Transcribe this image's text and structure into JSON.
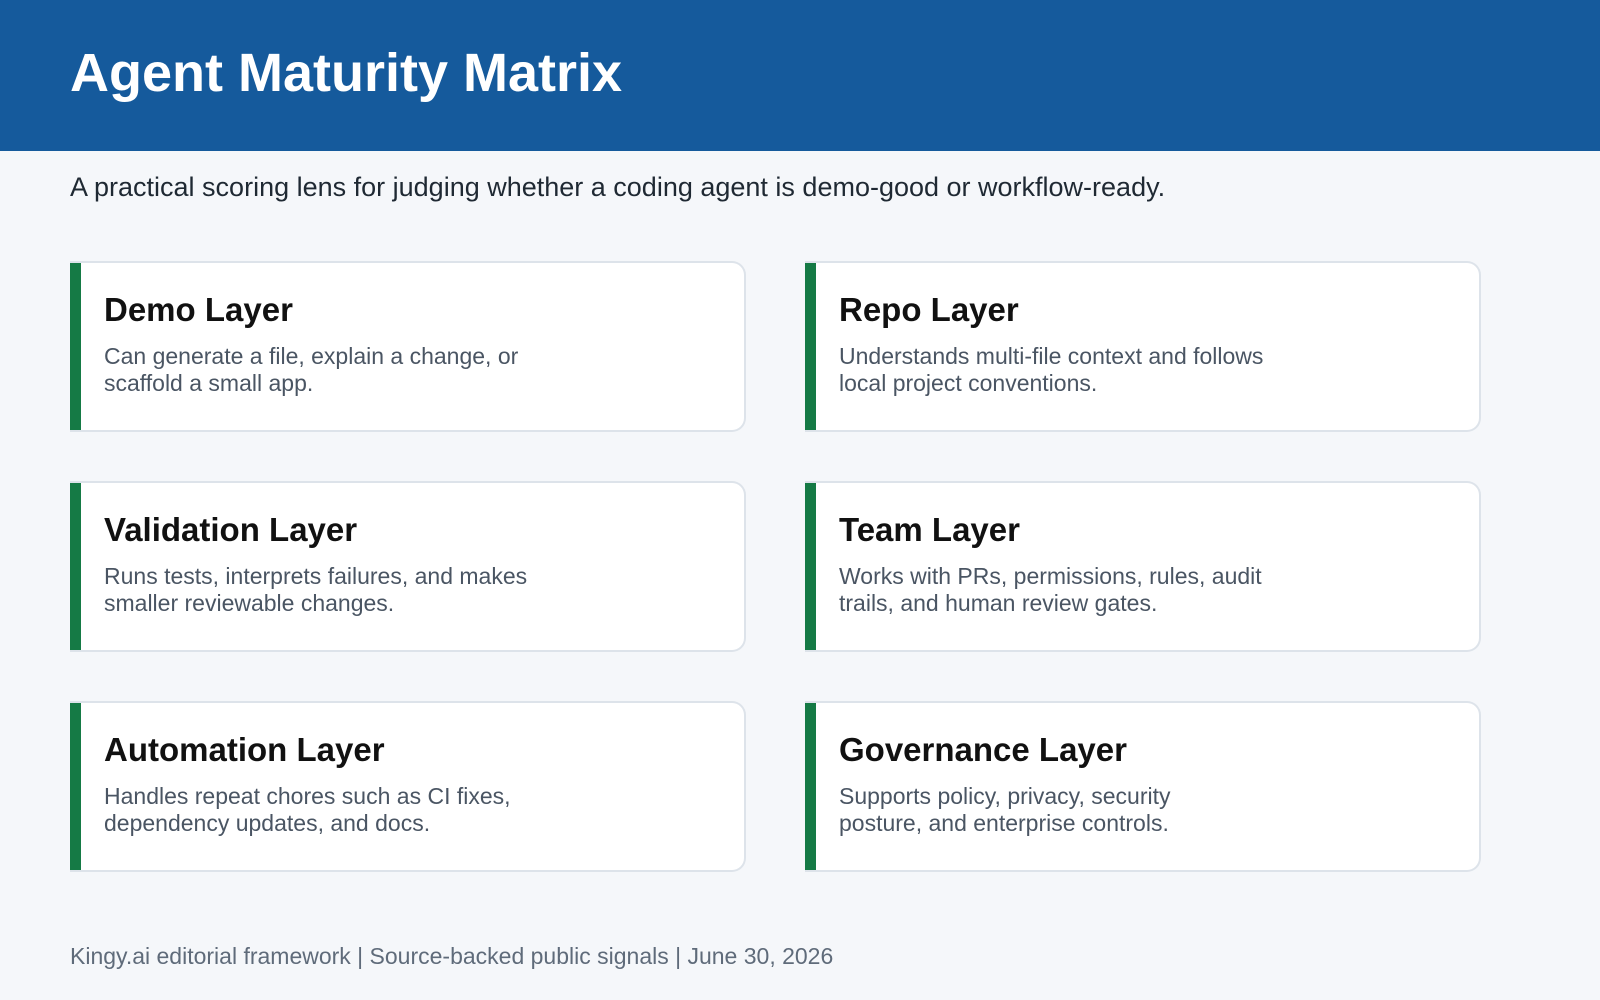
{
  "header": {
    "title": "Agent Maturity Matrix"
  },
  "subtitle": "A practical scoring lens for judging whether a coding agent is demo-good or workflow-ready.",
  "cards": [
    {
      "title": "Demo Layer",
      "description_line1": "Can generate a file, explain a change, or",
      "description_line2": "scaffold a small app."
    },
    {
      "title": "Repo Layer",
      "description_line1": "Understands multi-file context and follows",
      "description_line2": "local project conventions."
    },
    {
      "title": "Validation Layer",
      "description_line1": "Runs tests, interprets failures, and makes",
      "description_line2": "smaller reviewable changes."
    },
    {
      "title": "Team Layer",
      "description_line1": "Works with PRs, permissions, rules, audit",
      "description_line2": "trails, and human review gates."
    },
    {
      "title": "Automation Layer",
      "description_line1": "Handles repeat chores such as CI fixes,",
      "description_line2": "dependency updates, and docs."
    },
    {
      "title": "Governance Layer",
      "description_line1": "Supports policy, privacy, security",
      "description_line2": "posture, and enterprise controls."
    }
  ],
  "footer": "Kingy.ai editorial framework | Source-backed public signals | June 30, 2026",
  "colors": {
    "header_background": "#155a9c",
    "card_accent": "#157a45",
    "page_background": "#f5f7fa"
  }
}
